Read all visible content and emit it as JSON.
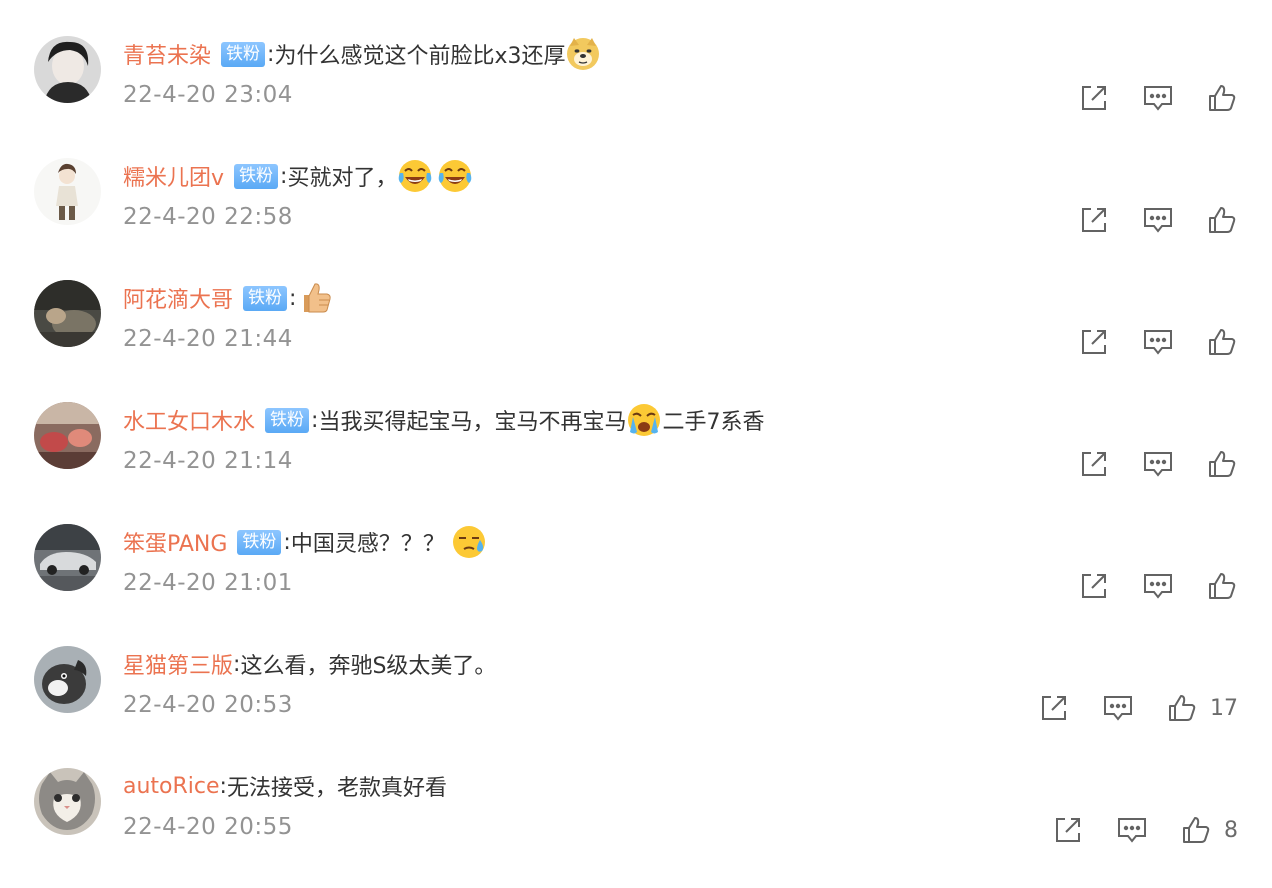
{
  "colors": {
    "username": "#eb7350",
    "badge": "#6fb5f8",
    "time": "#939393",
    "icon": "#636363"
  },
  "comments": [
    {
      "user": "青苔未染",
      "badge": "铁粉",
      "text": "为什么感觉这个前脸比x3还厚",
      "emoji": "doge-icon",
      "text2": "",
      "time": "22-4-20 23:04",
      "likes": ""
    },
    {
      "user": "糯米儿团v",
      "badge": "铁粉",
      "text": "买就对了，",
      "emoji": "laugh-cry-icon",
      "text2": "",
      "time": "22-4-20 22:58",
      "likes": ""
    },
    {
      "user": "阿花滴大哥",
      "badge": "铁粉",
      "text": "",
      "emoji": "thumbs-up-icon",
      "text2": "",
      "time": "22-4-20 21:44",
      "likes": ""
    },
    {
      "user": "水工女口木水",
      "badge": "铁粉",
      "text": "当我买得起宝马，宝马不再宝马",
      "emoji": "loudly-crying-icon",
      "text2": "二手7系香",
      "time": "22-4-20 21:14",
      "likes": ""
    },
    {
      "user": "笨蛋PANG",
      "badge": "铁粉",
      "text": "中国灵感？？？",
      "emoji": "sweat-face-icon",
      "text2": "",
      "time": "22-4-20 21:01",
      "likes": ""
    },
    {
      "user": "星猫第三版",
      "badge": "",
      "text": "这么看，奔驰S级太美了。",
      "emoji": "",
      "text2": "",
      "time": "22-4-20 20:53",
      "likes": "17"
    },
    {
      "user": "autoRice",
      "badge": "",
      "text": "无法接受，老款真好看",
      "emoji": "",
      "text2": "",
      "time": "22-4-20 20:55",
      "likes": "8"
    }
  ]
}
